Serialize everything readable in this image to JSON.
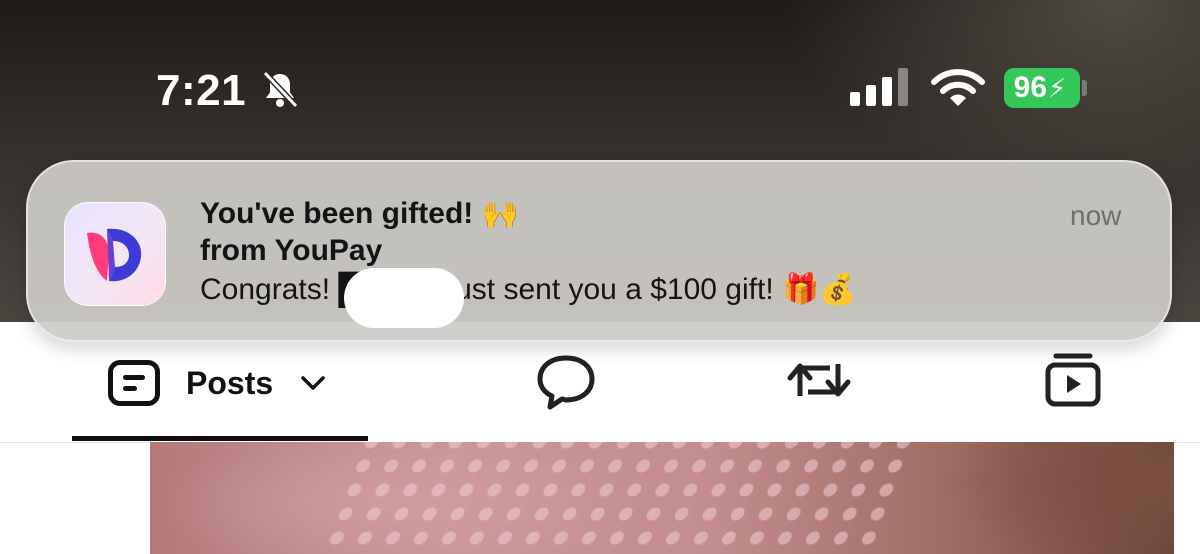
{
  "status_bar": {
    "time": "7:21",
    "battery_level": "96",
    "silent_mode_icon": "bell-slash-icon",
    "signal_icon": "cellular-signal-icon",
    "wifi_icon": "wifi-icon",
    "battery_color": "#34c759"
  },
  "notification": {
    "title": "You've been gifted! 🙌",
    "source": "from YouPay",
    "body": "Congrats! ████h just sent you a $100 gift! 🎁💰",
    "time": "now",
    "app_icon": "youpay-app-icon"
  },
  "profile_tabs": {
    "posts_label": "Posts",
    "posts_icon": "posts-icon",
    "replies_icon": "chat-bubble-icon",
    "reposts_icon": "repost-icon",
    "media_icon": "media-icon"
  }
}
